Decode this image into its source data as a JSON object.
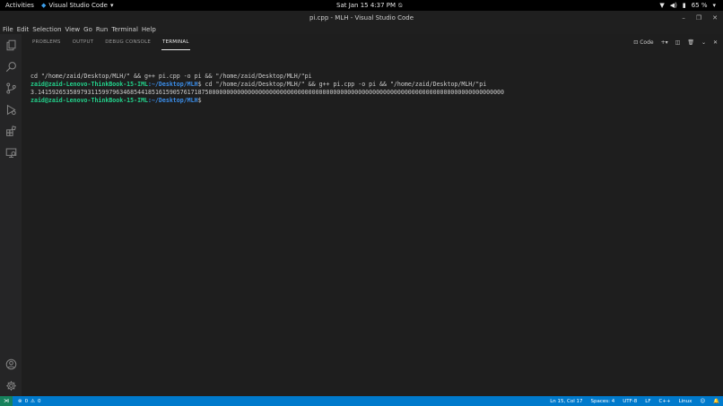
{
  "topbar": {
    "activities": "Activities",
    "app_name": "Visual Studio Code",
    "clock": "Sat Jan 15   4:37 PM",
    "battery": "65 %"
  },
  "window": {
    "title": "pi.cpp - MLH - Visual Studio Code"
  },
  "menu": [
    "File",
    "Edit",
    "Selection",
    "View",
    "Go",
    "Run",
    "Terminal",
    "Help"
  ],
  "panel": {
    "tabs": [
      "PROBLEMS",
      "OUTPUT",
      "DEBUG CONSOLE",
      "TERMINAL"
    ],
    "active_tab": "TERMINAL",
    "terminal_name": "Code"
  },
  "terminal": {
    "line1": "cd \"/home/zaid/Desktop/MLH/\" && g++ pi.cpp -o pi && \"/home/zaid/Desktop/MLH/\"pi",
    "prompt_user": "zaid@zaid-Lenovo-ThinkBook-15-IML",
    "prompt_path": ":~/Desktop/MLH",
    "prompt_symbol": "$",
    "line2_cmd": " cd \"/home/zaid/Desktop/MLH/\" && g++ pi.cpp -o pi && \"/home/zaid/Desktop/MLH/\"pi",
    "output": "3.14159265358979311599796346854418516159057617187500000000000000000000000000000000000000000000000000000000000000000000000000000000000"
  },
  "status": {
    "errors": "0",
    "warnings": "0",
    "position": "Ln 15, Col 17",
    "spaces": "Spaces: 4",
    "encoding": "UTF-8",
    "eol": "LF",
    "language": "C++",
    "os": "Linux"
  },
  "colors": {
    "accent": "#007acc",
    "prompt_user": "#23d18b",
    "prompt_path": "#3b8eea"
  }
}
